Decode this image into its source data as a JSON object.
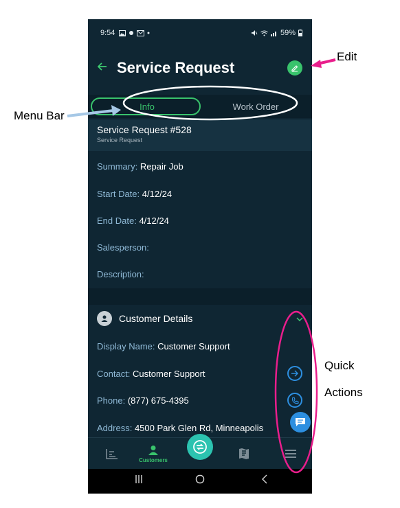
{
  "status_bar": {
    "time": "9:54",
    "battery": "59%"
  },
  "header": {
    "title": "Service Request"
  },
  "tabs": [
    {
      "label": "Info"
    },
    {
      "label": "Work Order"
    }
  ],
  "request": {
    "title": "Service Request #528",
    "subtitle": "Service Request"
  },
  "fields": [
    {
      "label": "Summary:",
      "value": "Repair Job"
    },
    {
      "label": "Start Date:",
      "value": "4/12/24"
    },
    {
      "label": "End Date:",
      "value": "4/12/24"
    },
    {
      "label": "Salesperson:",
      "value": ""
    },
    {
      "label": "Description:",
      "value": ""
    }
  ],
  "customer": {
    "section_title": "Customer Details",
    "fields": [
      {
        "label": "Display Name:",
        "value": "Customer Support"
      },
      {
        "label": "Contact:",
        "value": "Customer Support"
      },
      {
        "label": "Phone:",
        "value": "(877) 675-4395"
      },
      {
        "label": "Address:",
        "value": "4500 Park Glen Rd,  Minneapolis"
      }
    ]
  },
  "bottom_nav": {
    "active_label": "Customers"
  },
  "annotations": {
    "edit": "Edit",
    "menu_bar": "Menu Bar",
    "quick_line1": "Quick",
    "quick_line2": "Actions"
  },
  "colors": {
    "accent": "#39c36c",
    "annotation": "#e91e8c",
    "link_blue": "#2d8fe0"
  }
}
